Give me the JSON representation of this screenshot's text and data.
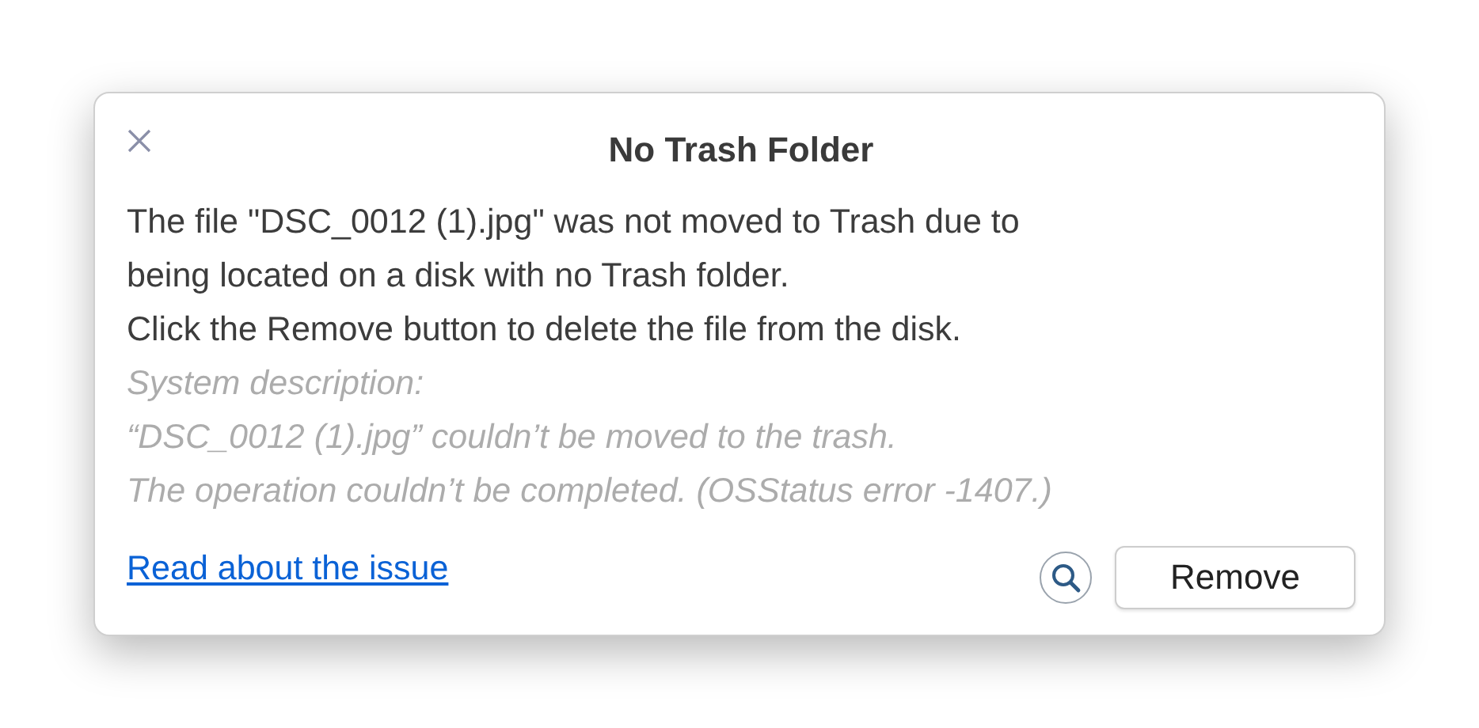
{
  "dialog": {
    "title": "No Trash Folder",
    "message_lines": [
      "The file \"DSC_0012 (1).jpg\" was not moved to Trash due to",
      "being located on a disk with no Trash folder.",
      "Click the Remove button to delete the file  from the disk."
    ],
    "description_lines": [
      "System description:",
      "“DSC_0012 (1).jpg” couldn’t be moved to the trash.",
      "The operation couldn’t be completed. (OSStatus error -1407.)"
    ],
    "link": "Read about the issue",
    "buttons": [
      "Remove"
    ]
  }
}
